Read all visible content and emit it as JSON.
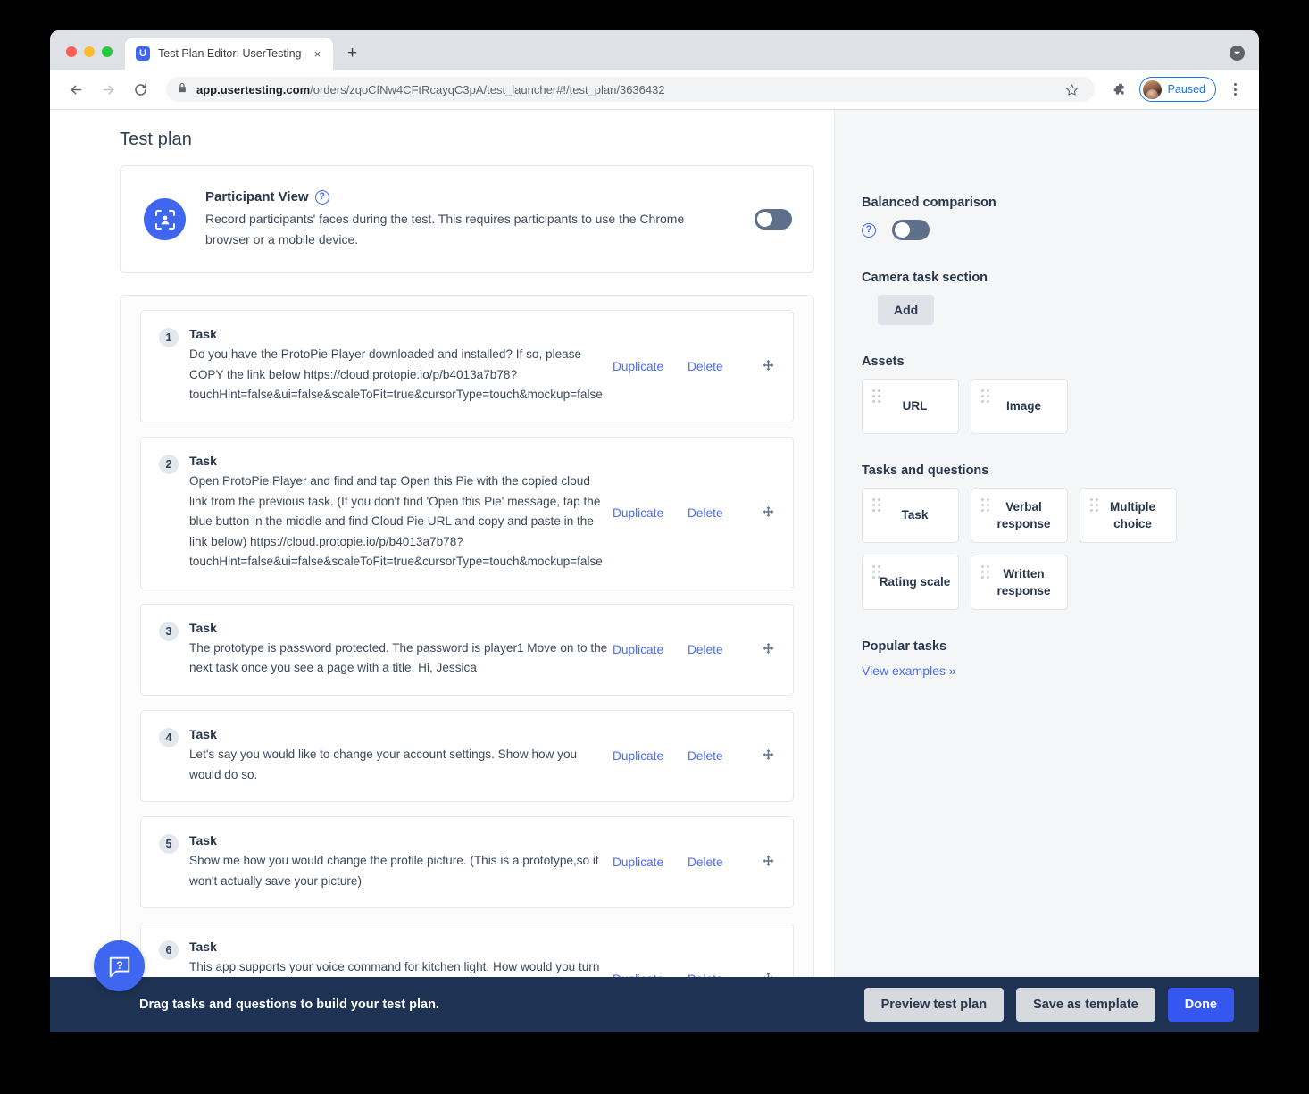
{
  "browser": {
    "tab": {
      "title": "Test Plan Editor: UserTesting",
      "favicon_letter": "U",
      "close_label": "×"
    },
    "new_tab_label": "+",
    "address": {
      "host": "app.usertesting.com",
      "path": "/orders/zqoCfNw4CFtRcayqC3pA/test_launcher#!/test_plan/3636432"
    },
    "profile": {
      "label": "Paused"
    }
  },
  "main": {
    "page_title": "Test plan",
    "participant_view": {
      "title": "Participant View",
      "help": "?",
      "description": "Record participants' faces during the test. This requires participants to use the Chrome browser or a mobile device.",
      "toggle_state": "off"
    },
    "task_label": "Task",
    "duplicate_label": "Duplicate",
    "delete_label": "Delete",
    "tasks": [
      {
        "num": "1",
        "label": "Task",
        "text": "Do you have the ProtoPie Player downloaded and installed? If so, please COPY the link below https://cloud.protopie.io/p/b4013a7b78?touchHint=false&ui=false&scaleToFit=true&cursorType=touch&mockup=false"
      },
      {
        "num": "2",
        "label": "Task",
        "text": "Open ProtoPie Player and find and tap Open this Pie with the copied cloud link from the previous task. (If you don't find 'Open this Pie' message, tap the blue button in the middle and find Cloud Pie URL and copy and paste in the link below) https://cloud.protopie.io/p/b4013a7b78?touchHint=false&ui=false&scaleToFit=true&cursorType=touch&mockup=false"
      },
      {
        "num": "3",
        "label": "Task",
        "text": "The prototype is password protected. The password is player1 Move on to the next task once you see a page with a title, Hi, Jessica"
      },
      {
        "num": "4",
        "label": "Task",
        "text": "Let's say you would like to change your account settings. Show how you would do so."
      },
      {
        "num": "5",
        "label": "Task",
        "text": "Show me how you would change the profile picture. (This is a prototype,so it won't actually save your picture)"
      },
      {
        "num": "6",
        "label": "Task",
        "text": "This app supports your voice command for kitchen light. How would you turn off the kitchen light using this app? Show me how you would use your voice to turn off the lights at kitchen."
      }
    ]
  },
  "sidebar": {
    "balanced_comparison": {
      "title": "Balanced comparison",
      "help": "?",
      "toggle_state": "off"
    },
    "camera_task_section": {
      "title": "Camera task section",
      "add_label": "Add"
    },
    "assets": {
      "title": "Assets",
      "items": [
        {
          "label": "URL"
        },
        {
          "label": "Image"
        }
      ]
    },
    "tasks_and_questions": {
      "title": "Tasks and questions",
      "items": [
        {
          "label": "Task"
        },
        {
          "label": "Verbal response"
        },
        {
          "label": "Multiple choice"
        },
        {
          "label": "Rating scale"
        },
        {
          "label": "Written response"
        }
      ]
    },
    "popular_tasks": {
      "title": "Popular tasks",
      "link": "View examples »"
    }
  },
  "bottom_bar": {
    "message": "Drag tasks and questions to build your test plan.",
    "preview_label": "Preview test plan",
    "save_template_label": "Save as template",
    "done_label": "Done"
  },
  "help_widget": {
    "glyph": "?"
  },
  "colors": {
    "accent": "#3f66ef",
    "link": "#4a6cf7",
    "bottom_bar": "#1e3253",
    "primary_button": "#3556f0"
  }
}
